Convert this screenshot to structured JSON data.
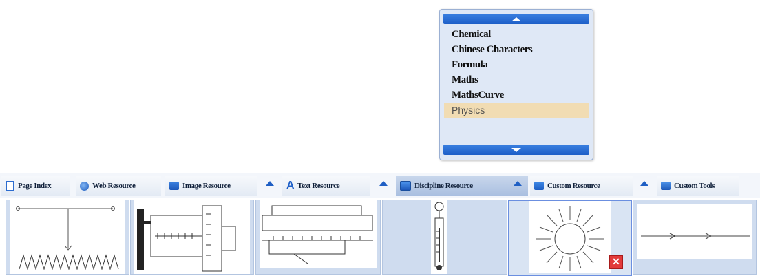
{
  "dropdown": {
    "items": [
      {
        "label": "Chemical"
      },
      {
        "label": "Chinese Characters"
      },
      {
        "label": "Formula"
      },
      {
        "label": "Maths"
      },
      {
        "label": "MathsCurve"
      },
      {
        "label": "Physics",
        "selected": true
      }
    ]
  },
  "tabs": [
    {
      "label": "Page Index",
      "icon": "page-icon"
    },
    {
      "label": "Web Resource",
      "icon": "globe-icon"
    },
    {
      "label": "Image Resource",
      "icon": "folder-icon"
    },
    {
      "label": "Text Resource",
      "icon": "text-a-icon"
    },
    {
      "label": "Discipline Resource",
      "icon": "discipline-icon",
      "active": true
    },
    {
      "label": "Custom Resource",
      "icon": "custom-resource-icon"
    },
    {
      "label": "Custom Tools",
      "icon": "toolbox-icon"
    }
  ],
  "thumbnails": [
    {
      "name": "spring-oscillator"
    },
    {
      "name": "micrometer"
    },
    {
      "name": "vernier-caliper"
    },
    {
      "name": "thermometer"
    },
    {
      "name": "light-source",
      "has_close": true
    },
    {
      "name": "light-ray"
    }
  ],
  "colors": {
    "accent": "#1d5fc8",
    "selected_item": "#f1dcb3",
    "panel": "#dfe8f6"
  },
  "close_glyph": "✕"
}
